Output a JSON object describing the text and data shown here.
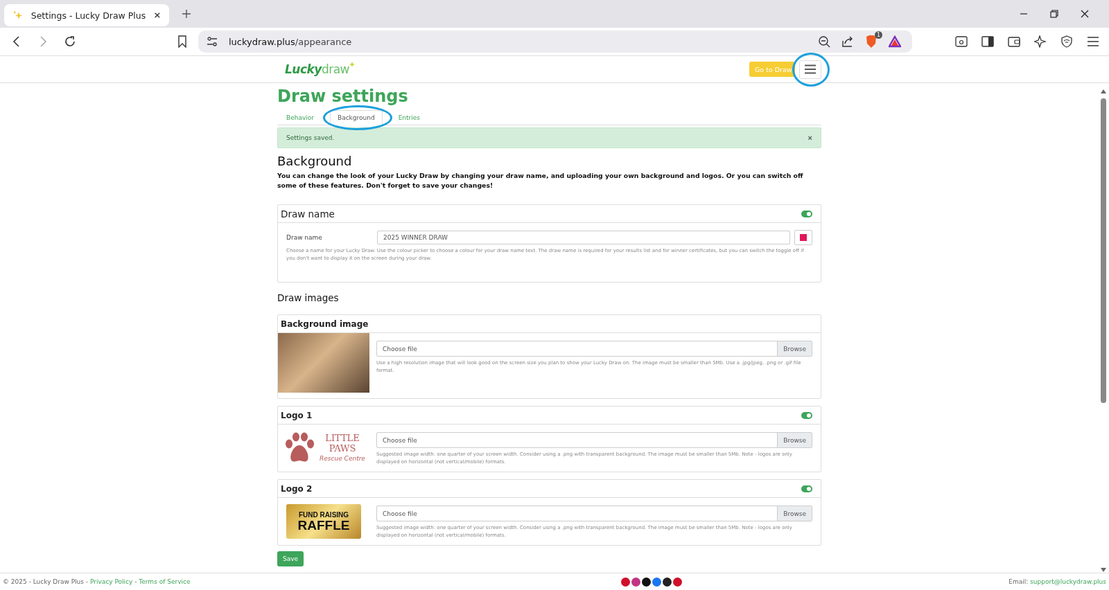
{
  "browser": {
    "tab_title": "Settings - Lucky Draw Plus",
    "url_host": "luckydraw.plus",
    "url_path": "/appearance",
    "shield_badge": "1"
  },
  "header": {
    "logo_bold": "Lucky",
    "logo_light": "draw",
    "go_button": "Go to Draw"
  },
  "page": {
    "title": "Draw settings",
    "tabs": [
      {
        "label": "Behavior",
        "selected": false
      },
      {
        "label": "Background",
        "selected": true
      },
      {
        "label": "Entries",
        "selected": false
      }
    ],
    "alert": {
      "text": "Settings saved.",
      "close": "×"
    },
    "heading": "Background",
    "intro": "You can change the look of your Lucky Draw by changing your draw name, and uploading your own background and logos. Or you can switch off some of these features. Don't forget to save your changes!",
    "draw_name": {
      "title": "Draw name",
      "on": true,
      "label": "Draw name",
      "value": "2025 WINNER DRAW",
      "color": "#e0185a",
      "help": "Choose a name for your Lucky Draw. Use the colour picker to choose a colour for your draw name text. The draw name is required for your results list and for winner certificates, but you can switch the toggle off if you don't want to display it on the screen during your draw."
    },
    "images_heading": "Draw images",
    "images": [
      {
        "kind": "photo",
        "title": "Background image",
        "placeholder": "Choose file",
        "browse": "Browse",
        "help": "Use a high resolution image that will look good on the screen size you plan to show your Lucky Draw on. The image must be smaller than 5Mb. Use a .jpg/jpeg, .png or .gif file format."
      },
      {
        "kind": "paws",
        "title": "Logo 1",
        "on": true,
        "logo_lines": [
          "LITTLE",
          "PAWS",
          "Rescue Centre"
        ],
        "placeholder": "Choose file",
        "browse": "Browse",
        "help": "Suggested image width: one quarter of your screen width. Consider using a .png with transparent background. The image must be smaller than 5Mb. Note - logos are only displayed on horizontal (not vertical/mobile) formats."
      },
      {
        "kind": "raffle",
        "title": "Logo 2",
        "on": true,
        "logo_lines": [
          "FUND RAISING",
          "RAFFLE"
        ],
        "placeholder": "Choose file",
        "browse": "Browse",
        "help": "Suggested image width: one quarter of your screen width. Consider using a .png with transparent background. The image must be smaller than 5Mb. Note - logos are only displayed on horizontal (not vertical/mobile) formats."
      }
    ],
    "save": "Save"
  },
  "footer": {
    "copyright": "© 2025 - Lucky Draw Plus - ",
    "privacy": "Privacy Policy",
    "sep": " - ",
    "terms": "Terms of Service",
    "email_label": "Email: ",
    "email": "support@luckydraw.plus"
  }
}
